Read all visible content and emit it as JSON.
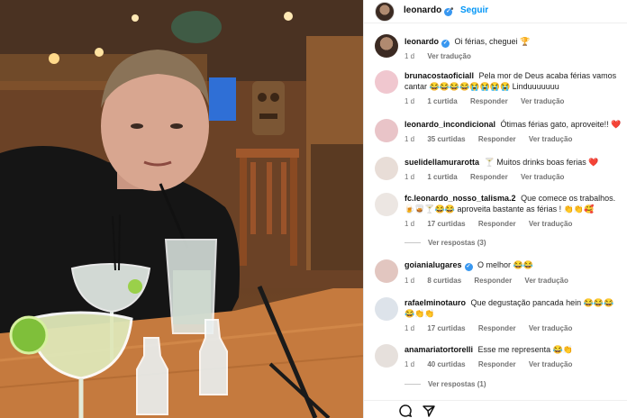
{
  "post": {
    "username": "leonardo",
    "separator": "•",
    "follow_label": "Seguir"
  },
  "caption": {
    "username": "leonardo",
    "text": "Oi férias, cheguei 🏆",
    "time": "1 d",
    "translate": "Ver tradução"
  },
  "comments": [
    {
      "username": "brunacostaoficiall",
      "text": "Pela mor de Deus acaba férias vamos cantar 😂😂😂😂😭😭😭😭 Linduuuuuuu",
      "time": "1 d",
      "likes": "1 curtida",
      "reply": "Responder",
      "translate": "Ver tradução"
    },
    {
      "username": "leonardo_incondicional",
      "text": "Ótimas férias gato, aproveite!! ❤️",
      "time": "1 d",
      "likes": "35 curtidas",
      "reply": "Responder",
      "translate": "Ver tradução"
    },
    {
      "username": "suelidellamurarotta",
      "text": "🍸 Muitos drinks boas ferias ❤️",
      "time": "1 d",
      "likes": "1 curtida",
      "reply": "Responder",
      "translate": "Ver tradução"
    },
    {
      "username": "fc.leonardo_nosso_talisma.2",
      "text": "Que comece os trabalhos. 🍺🥃🍸😂😂 aproveita bastante as férias ! 👏👏🥰",
      "time": "1 d",
      "likes": "17 curtidas",
      "reply": "Responder",
      "translate": "Ver tradução",
      "view_replies": "Ver respostas (3)"
    },
    {
      "username": "goianialugares",
      "text": "O melhor 😂😂",
      "time": "1 d",
      "likes": "8 curtidas",
      "reply": "Responder",
      "translate": "Ver tradução"
    },
    {
      "username": "rafaelminotauro",
      "text": "Que degustação pancada hein 😂😂😂😂👏👏",
      "time": "1 d",
      "likes": "17 curtidas",
      "reply": "Responder",
      "translate": "Ver tradução"
    },
    {
      "username": "anamariatortorelli",
      "text": "Esse me representa 😂👏",
      "time": "1 d",
      "likes": "40 curtidas",
      "reply": "Responder",
      "translate": "Ver tradução",
      "view_replies": "Ver respostas (1)"
    }
  ],
  "colors": {
    "link_blue": "#0095f6",
    "verified_blue": "#3897f0",
    "heart_red": "#e0245e"
  },
  "icons": {
    "footer_left": "comment-icon",
    "footer_right": "share-icon",
    "verified": "verified-badge-icon"
  }
}
